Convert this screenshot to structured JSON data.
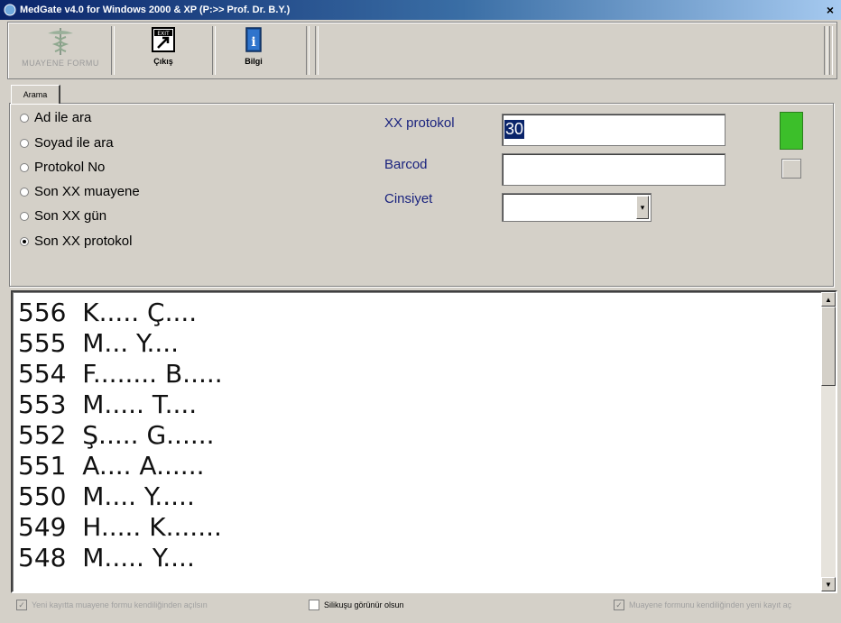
{
  "window": {
    "title": "MedGate v4.0 for Windows 2000 & XP (P:>> Prof. Dr. B.Y.)",
    "close_glyph": "×"
  },
  "toolbar": {
    "buttons": [
      {
        "label": "MUAYENE FORMU",
        "icon": "caduceus-icon",
        "enabled": false
      },
      {
        "label": "Çıkış",
        "icon": "exit-icon",
        "enabled": true
      },
      {
        "label": "Bilgi",
        "icon": "info-book-icon",
        "enabled": true
      }
    ]
  },
  "tabs": [
    {
      "label": "Arama"
    }
  ],
  "search": {
    "options": [
      {
        "label": "Ad ile ara",
        "selected": false
      },
      {
        "label": "Soyad ile ara",
        "selected": false
      },
      {
        "label": "Protokol No",
        "selected": false
      },
      {
        "label": "Son XX muayene",
        "selected": false
      },
      {
        "label": "Son XX gün",
        "selected": false
      },
      {
        "label": "Son XX protokol",
        "selected": true
      }
    ],
    "fields": {
      "xx_protokol": {
        "label": "XX protokol",
        "value": "30"
      },
      "barcod": {
        "label": "Barcod",
        "value": ""
      },
      "cinsiyet": {
        "label": "Cinsiyet",
        "value": ""
      }
    },
    "indicator_color": "#3cbf2a"
  },
  "results": [
    {
      "no": "556",
      "name": "K..... Ç...."
    },
    {
      "no": "555",
      "name": "M... Y...."
    },
    {
      "no": "554",
      "name": "F........ B....."
    },
    {
      "no": "553",
      "name": "M..... T...."
    },
    {
      "no": "552",
      "name": "Ş..... G......"
    },
    {
      "no": "551",
      "name": "A.... A......"
    },
    {
      "no": "550",
      "name": "M.... Y....."
    },
    {
      "no": "549",
      "name": "H..... K......."
    },
    {
      "no": "548",
      "name": "M..... Y...."
    }
  ],
  "footer": {
    "checkboxes": [
      {
        "label": "Yeni kayıtta muayene formu kendiliğinden açılsın",
        "checked": true,
        "enabled": false
      },
      {
        "label": "Silikuşu görünür olsun",
        "checked": false,
        "enabled": true
      },
      {
        "label": "Muayene formunu kendiliğinden yeni kayıt aç",
        "checked": true,
        "enabled": false
      }
    ]
  }
}
